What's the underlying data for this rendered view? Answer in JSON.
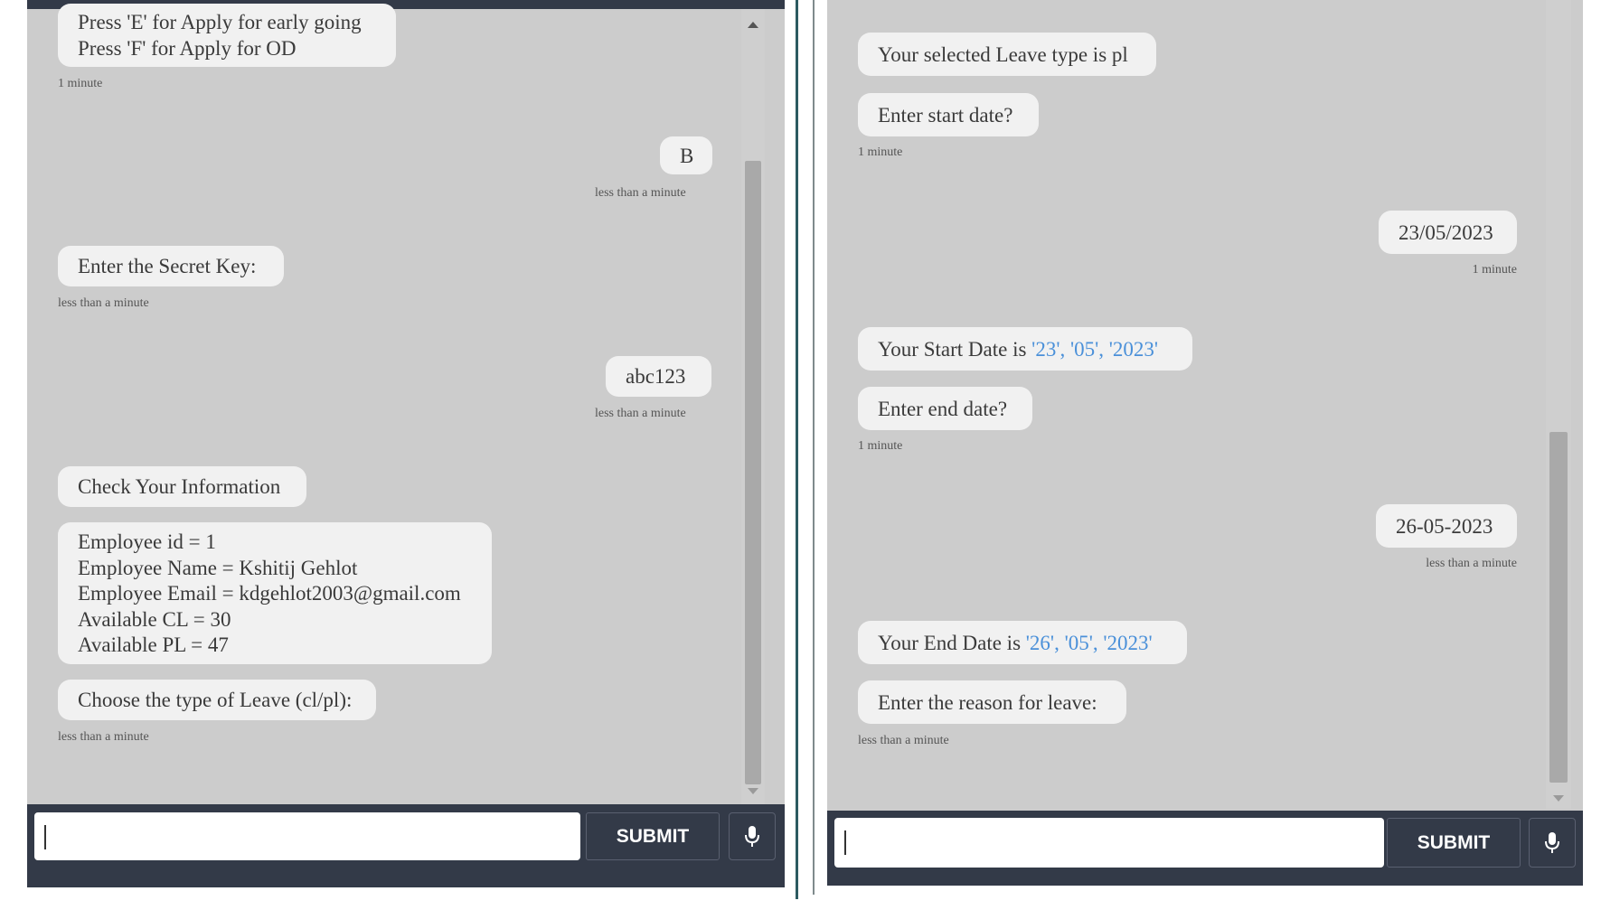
{
  "left": {
    "messages": [
      {
        "lines": [
          "Press 'E' for Apply for early going",
          "Press 'F' for Apply for OD"
        ]
      },
      {
        "ts": "1 minute"
      },
      {
        "text": "B"
      },
      {
        "ts": "less than a minute"
      },
      {
        "text": "Enter the Secret Key:"
      },
      {
        "ts": "less than a minute"
      },
      {
        "text": "abc123"
      },
      {
        "ts": "less than a minute"
      },
      {
        "text": "Check Your Information"
      },
      {
        "lines": [
          "Employee id = 1",
          "Employee Name = Kshitij Gehlot",
          "Employee Email = kdgehlot2003@gmail.com",
          "Available CL = 30",
          "Available PL = 47"
        ]
      },
      {
        "text": "Choose the type of Leave (cl/pl):"
      },
      {
        "ts": "less than a minute"
      }
    ],
    "input": {
      "value": "",
      "placeholder": ""
    },
    "submit_label": "SUBMIT"
  },
  "right": {
    "messages": [
      {
        "text": "Your selected Leave type is pl"
      },
      {
        "text": "Enter start date?"
      },
      {
        "ts": "1 minute"
      },
      {
        "text": "23/05/2023"
      },
      {
        "ts": "1 minute"
      },
      {
        "prefix": "Your Start Date is ",
        "highlight": "'23', '05', '2023'"
      },
      {
        "text": "Enter end date?"
      },
      {
        "ts": "1 minute"
      },
      {
        "text": "26-05-2023"
      },
      {
        "ts": "less than a minute"
      },
      {
        "prefix": "Your End Date is ",
        "highlight": "'26', '05', '2023'"
      },
      {
        "text": "Enter the reason for leave:"
      },
      {
        "ts": "less than a minute"
      }
    ],
    "input": {
      "value": "",
      "placeholder": ""
    },
    "submit_label": "SUBMIT"
  },
  "icons": {
    "mic": "microphone-icon",
    "scroll_up": "chevron-up-icon",
    "scroll_down": "chevron-down-icon"
  },
  "colors": {
    "panel": "#cccccc",
    "bubble": "#f1f1f1",
    "bar": "#333a48",
    "link": "#4a90d9"
  }
}
